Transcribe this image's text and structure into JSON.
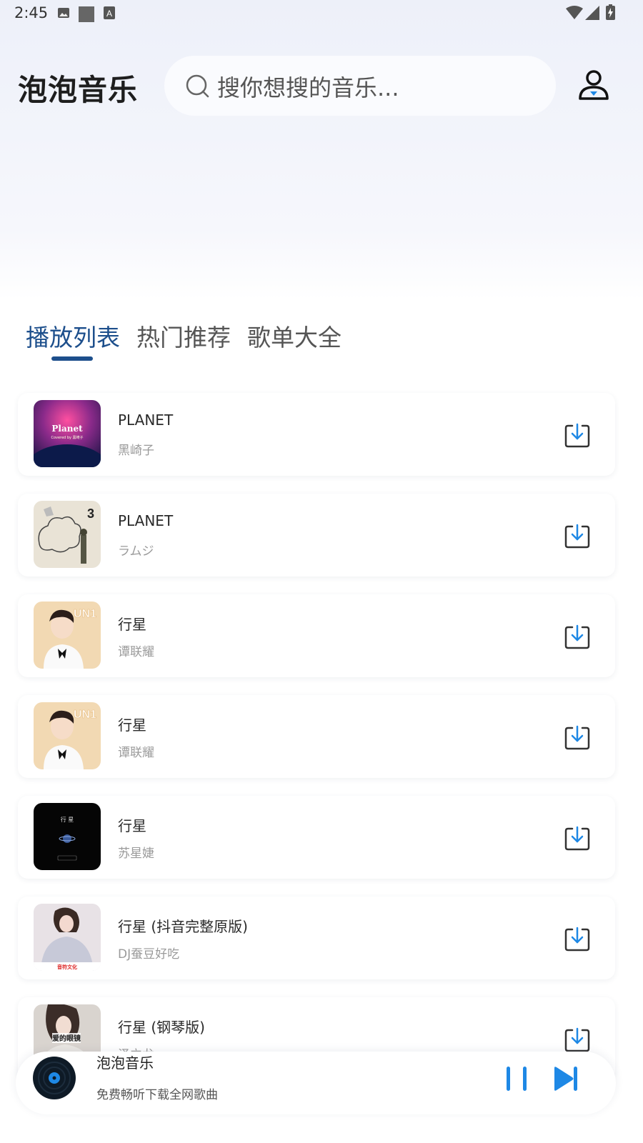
{
  "status_bar": {
    "time": "2:45",
    "left_icons": [
      "image-icon",
      "square-icon",
      "a-badge-icon"
    ],
    "right_icons": [
      "wifi-icon",
      "signal-icon",
      "battery-charging-icon"
    ]
  },
  "header": {
    "app_title": "泡泡音乐",
    "search_placeholder": "搜你想搜的音乐...",
    "profile_icon": "person-icon"
  },
  "tabs": [
    {
      "label": "播放列表",
      "active": true
    },
    {
      "label": "热门推荐",
      "active": false
    },
    {
      "label": "歌单大全",
      "active": false
    }
  ],
  "songs": [
    {
      "title": "PLANET",
      "artist": "黑崎子",
      "cover_text": "Planet",
      "cover_subtext": "Covered by 黑崎子"
    },
    {
      "title": "PLANET",
      "artist": "ラムジ",
      "cover_text": "3"
    },
    {
      "title": "行星",
      "artist": "谭联耀",
      "cover_text": "UN1"
    },
    {
      "title": "行星",
      "artist": "谭联耀",
      "cover_text": "UN1"
    },
    {
      "title": "行星",
      "artist": "苏星婕",
      "cover_text": "行 星"
    },
    {
      "title": "行星 (抖音完整原版)",
      "artist": "DJ蚕豆好吃",
      "cover_text": "音符文化"
    },
    {
      "title": "行星 (钢琴版)",
      "artist": "泽立龙",
      "cover_text": "爱的眼镜"
    }
  ],
  "player": {
    "title": "泡泡音乐",
    "subtitle": "免费畅听下载全网歌曲",
    "accent_color": "#1e88e5"
  },
  "colors": {
    "tab_active": "#1d4f8c",
    "tab_inactive": "#555555",
    "accent": "#1e88e5"
  }
}
